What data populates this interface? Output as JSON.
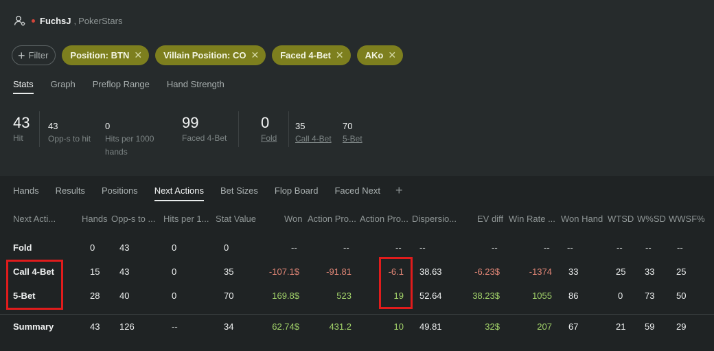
{
  "player": {
    "name": "FuchsJ",
    "site": "PokerStars",
    "icon": "user-settings-icon"
  },
  "filter": {
    "add_label": "Filter"
  },
  "chips": [
    {
      "label": "Position: BTN"
    },
    {
      "label": "Villain Position: CO"
    },
    {
      "label": "Faced 4-Bet"
    },
    {
      "label": "AKo"
    }
  ],
  "main_tabs": [
    "Stats",
    "Graph",
    "Preflop Range",
    "Hand Strength"
  ],
  "summary": {
    "hit": {
      "value": "43",
      "label": "Hit"
    },
    "opps": {
      "value": "43",
      "label": "Opp-s to hit"
    },
    "hits_per": {
      "value": "0",
      "label1": "Hits per 1000",
      "label2": "hands"
    },
    "faced": {
      "value": "99",
      "label": "Faced 4-Bet"
    },
    "fold": {
      "value": "0",
      "label": "Fold"
    },
    "call": {
      "value": "35",
      "label": "Call 4-Bet"
    },
    "fivebet": {
      "value": "70",
      "label": "5-Bet"
    }
  },
  "sub_tabs": [
    "Hands",
    "Results",
    "Positions",
    "Next Actions",
    "Bet Sizes",
    "Flop Board",
    "Faced Next"
  ],
  "table": {
    "headers": [
      "Next Acti...",
      "Hands",
      "Opp-s to ...",
      "Hits per 1...",
      "Stat Value",
      "Won",
      "Action Pro...",
      "Action Pro...",
      "Dispersio...",
      "EV diff",
      "Win Rate ...",
      "Won Hand",
      "WTSD",
      "W%SD",
      "WWSF%"
    ],
    "rows": [
      [
        "Fold",
        "0",
        "43",
        "0",
        "0",
        "--",
        "--",
        "--",
        "--",
        "--",
        "--",
        "--",
        "--",
        "--",
        "--"
      ],
      [
        "Call 4-Bet",
        "15",
        "43",
        "0",
        "35",
        "-107.1$",
        "-91.81",
        "-6.1",
        "38.63",
        "-6.23$",
        "-1374",
        "33",
        "25",
        "33",
        "25"
      ],
      [
        "5-Bet",
        "28",
        "40",
        "0",
        "70",
        "169.8$",
        "523",
        "19",
        "52.64",
        "38.23$",
        "1055",
        "86",
        "0",
        "73",
        "50"
      ]
    ],
    "summary_row": [
      "Summary",
      "43",
      "126",
      "--",
      "34",
      "62.74$",
      "431.2",
      "10",
      "49.81",
      "32$",
      "207",
      "67",
      "21",
      "59",
      "29"
    ]
  },
  "colors": {
    "chip": "#7d7f1e",
    "positive": "#a3d46a",
    "negative": "#e58878",
    "highlight_box": "#e01c1c"
  }
}
